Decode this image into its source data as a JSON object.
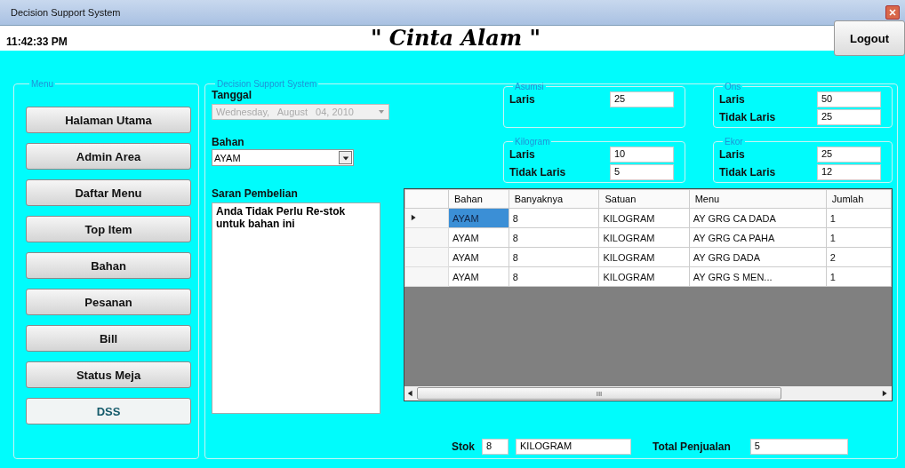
{
  "window": {
    "title": "Decision Support System"
  },
  "header": {
    "clock": "11:42:33 PM",
    "title": "\" Cinta Alam \"",
    "logout": "Logout"
  },
  "menu": {
    "title": "Menu",
    "items": [
      {
        "label": "Halaman Utama",
        "selected": false
      },
      {
        "label": "Admin Area",
        "selected": false
      },
      {
        "label": "Daftar Menu",
        "selected": false
      },
      {
        "label": "Top Item",
        "selected": false
      },
      {
        "label": "Bahan",
        "selected": false
      },
      {
        "label": "Pesanan",
        "selected": false
      },
      {
        "label": "Bill",
        "selected": false
      },
      {
        "label": "Status Meja",
        "selected": false
      },
      {
        "label": "DSS",
        "selected": true
      }
    ]
  },
  "dss": {
    "title": "Decision Support System",
    "tanggal": {
      "label": "Tanggal",
      "value": "Wednesday,   August   04, 2010",
      "disabled": true
    },
    "bahan": {
      "label": "Bahan",
      "value": "AYAM"
    },
    "saran": {
      "label": "Saran Pembelian",
      "text": "Anda Tidak Perlu Re-stok untuk bahan ini"
    },
    "groups": [
      {
        "title": "Asumsi",
        "rows": [
          {
            "label": "Laris",
            "value": "25"
          }
        ]
      },
      {
        "title": "Ons",
        "rows": [
          {
            "label": "Laris",
            "value": "50"
          },
          {
            "label": "Tidak Laris",
            "value": "25"
          }
        ]
      },
      {
        "title": "Kilogram",
        "rows": [
          {
            "label": "Laris",
            "value": "10"
          },
          {
            "label": "Tidak Laris",
            "value": "5"
          }
        ]
      },
      {
        "title": "Ekor",
        "rows": [
          {
            "label": "Laris",
            "value": "25"
          },
          {
            "label": "Tidak Laris",
            "value": "12"
          }
        ]
      }
    ],
    "table": {
      "columns": [
        "Bahan",
        "Banyaknya",
        "Satuan",
        "Menu",
        "Jumlah"
      ],
      "rows": [
        {
          "cells": [
            "AYAM",
            "8",
            "KILOGRAM",
            "AY GRG CA DADA",
            "1"
          ],
          "selected": true
        },
        {
          "cells": [
            "AYAM",
            "8",
            "KILOGRAM",
            "AY GRG CA PAHA",
            "1"
          ],
          "selected": false
        },
        {
          "cells": [
            "AYAM",
            "8",
            "KILOGRAM",
            "AY GRG DADA",
            "2"
          ],
          "selected": false
        },
        {
          "cells": [
            "AYAM",
            "8",
            "KILOGRAM",
            "AY GRG S MEN...",
            "1"
          ],
          "selected": false
        }
      ],
      "scroll_grip": "III"
    },
    "footer": {
      "stok_label": "Stok",
      "stok": "8",
      "satuan": "KILOGRAM",
      "total_label": "Total Penjualan",
      "total": "5"
    }
  }
}
